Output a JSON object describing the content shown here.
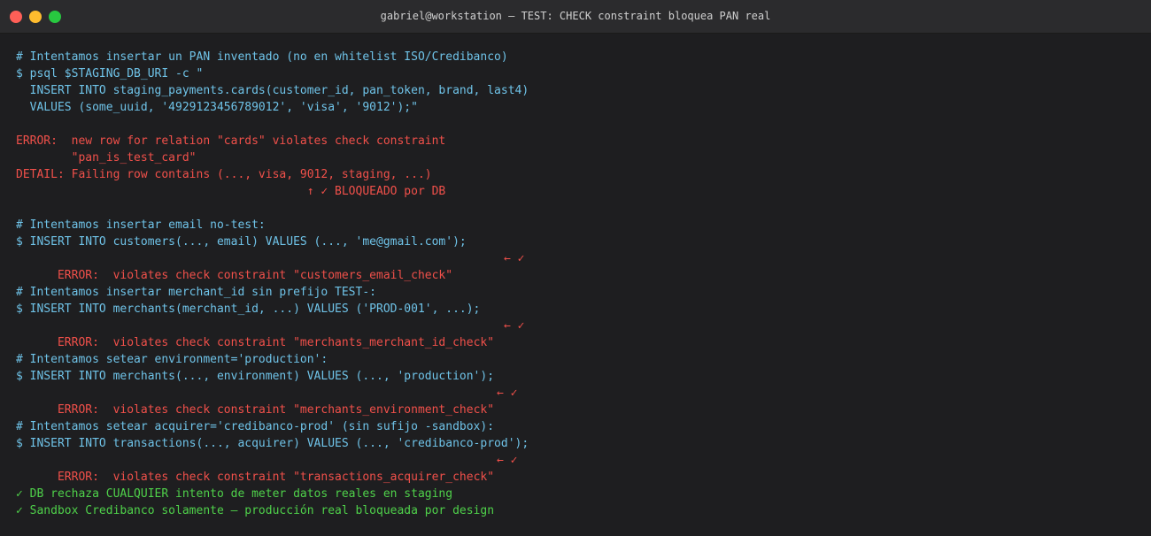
{
  "window": {
    "title": "gabriel@workstation — TEST: CHECK constraint bloquea PAN real"
  },
  "terminal": {
    "block1": {
      "comment": "# Intentamos insertar un PAN inventado (no en whitelist ISO/Credibanco)",
      "cmd1": "$ psql $STAGING_DB_URI -c \"",
      "cmd2": "  INSERT INTO staging_payments.cards(customer_id, pan_token, brand, last4)",
      "cmd3": "  VALUES (some_uuid, '4929123456789012', 'visa', '9012');\"",
      "err1": "ERROR:  new row for relation \"cards\" violates check constraint",
      "err2": "        \"pan_is_test_card\"",
      "err3": "DETAIL: Failing row contains (..., visa, 9012, staging, ...)",
      "err4": "                                          ↑ ✓ BLOQUEADO por DB"
    },
    "block2": {
      "comment": "# Intentamos insertar email no-test:",
      "cmd": "$ INSERT INTO customers(..., email) VALUES (..., 'me@gmail.com');",
      "err": "ERROR:  violates check constraint \"customers_email_check\"",
      "mark": "← ✓"
    },
    "block3": {
      "comment": "# Intentamos insertar merchant_id sin prefijo TEST-:",
      "cmd": "$ INSERT INTO merchants(merchant_id, ...) VALUES ('PROD-001', ...);",
      "err": "ERROR:  violates check constraint \"merchants_merchant_id_check\"",
      "mark": "← ✓"
    },
    "block4": {
      "comment": "# Intentamos setear environment='production':",
      "cmd": "$ INSERT INTO merchants(..., environment) VALUES (..., 'production');",
      "err": "ERROR:  violates check constraint \"merchants_environment_check\"",
      "mark": "← ✓"
    },
    "block5": {
      "comment": "# Intentamos setear acquirer='credibanco-prod' (sin sufijo -sandbox):",
      "cmd": "$ INSERT INTO transactions(..., acquirer) VALUES (..., 'credibanco-prod');",
      "err": "ERROR:  violates check constraint \"transactions_acquirer_check\"",
      "mark": "← ✓"
    },
    "summary": {
      "line1": "✓ DB rechaza CUALQUIER intento de meter datos reales en staging",
      "line2": "✓ Sandbox Credibanco solamente — producción real bloqueada por design"
    }
  },
  "colors": {
    "comment": "#6fc3e8",
    "error": "#f0504a",
    "success": "#4fd14a",
    "background": "#1e1e20"
  }
}
